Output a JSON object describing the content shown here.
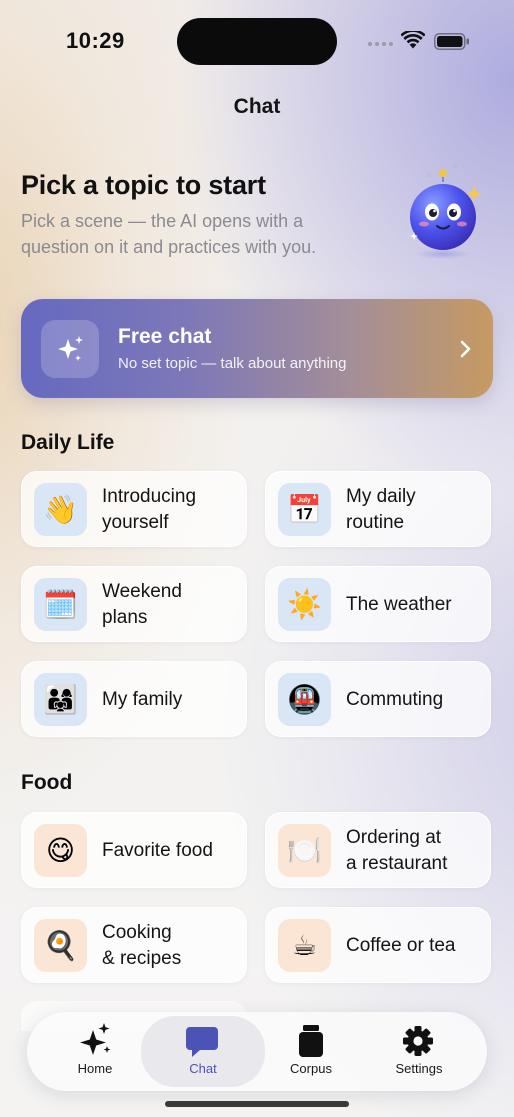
{
  "status": {
    "time": "10:29"
  },
  "nav": {
    "title": "Chat"
  },
  "hero": {
    "title": "Pick a topic to start",
    "subtitle": "Pick a scene — the AI opens with a question on it and practices with you."
  },
  "free_chat": {
    "title": "Free chat",
    "subtitle": "No set topic — talk about anything"
  },
  "sections": [
    {
      "title": "Daily Life",
      "items": [
        {
          "label": "Introducing\nyourself",
          "icon": "👋",
          "icon_name": "waving-hand-icon"
        },
        {
          "label": "My daily\nroutine",
          "icon": "📅",
          "icon_name": "calendar-icon"
        },
        {
          "label": "Weekend\nplans",
          "icon": "🗓️",
          "icon_name": "spiral-calendar-icon"
        },
        {
          "label": "The weather",
          "icon": "☀️",
          "icon_name": "sun-icon"
        },
        {
          "label": "My family",
          "icon": "👨‍👩‍👧",
          "icon_name": "family-icon"
        },
        {
          "label": "Commuting",
          "icon": "🚇",
          "icon_name": "metro-icon"
        }
      ]
    },
    {
      "title": "Food",
      "items": [
        {
          "label": "Favorite food",
          "icon": "😋",
          "icon_name": "yum-face-icon"
        },
        {
          "label": "Ordering at\na restaurant",
          "icon": "🍽️",
          "icon_name": "plate-cutlery-icon"
        },
        {
          "label": "Cooking\n& recipes",
          "icon": "🍳",
          "icon_name": "frying-pan-icon"
        },
        {
          "label": "Coffee or tea",
          "icon": "☕",
          "icon_name": "hot-beverage-icon"
        }
      ]
    }
  ],
  "tabs": [
    {
      "label": "Home",
      "icon": "sparkles-icon"
    },
    {
      "label": "Chat",
      "icon": "chat-bubble-icon",
      "active": true
    },
    {
      "label": "Corpus",
      "icon": "jar-icon"
    },
    {
      "label": "Settings",
      "icon": "gear-icon"
    }
  ],
  "colors": {
    "accent": "#4c53b6",
    "daily_icon_bg": "#d9e6f6",
    "food_icon_bg": "#fbe6d6"
  }
}
